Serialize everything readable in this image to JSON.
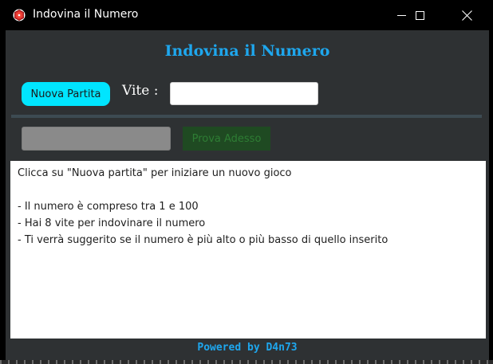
{
  "window": {
    "title": "Indovina il Numero",
    "icon": "game-icon",
    "controls": [
      "minimize-icon",
      "maximize-icon",
      "close-icon"
    ]
  },
  "main": {
    "heading": "Indovina il Numero",
    "new_game_label": "Nuova Partita",
    "lives_label": "Vite :",
    "lives_value": "",
    "guess_value": "",
    "try_label": "Prova Adesso",
    "message_lines": [
      "Clicca su \"Nuova partita\" per iniziare un nuovo gioco",
      "",
      "- Il numero è compreso tra 1 e 100",
      "- Hai 8 vite per indovinare il numero",
      "- Ti verrà suggerito se il numero è più alto o più basso di quello inserito"
    ],
    "footer": "Powered by D4n73"
  },
  "colors": {
    "accent": "#1ea7ee",
    "new_game_button": "#00e5ff",
    "try_button": "#1f4a22",
    "background": "#2e3133"
  }
}
